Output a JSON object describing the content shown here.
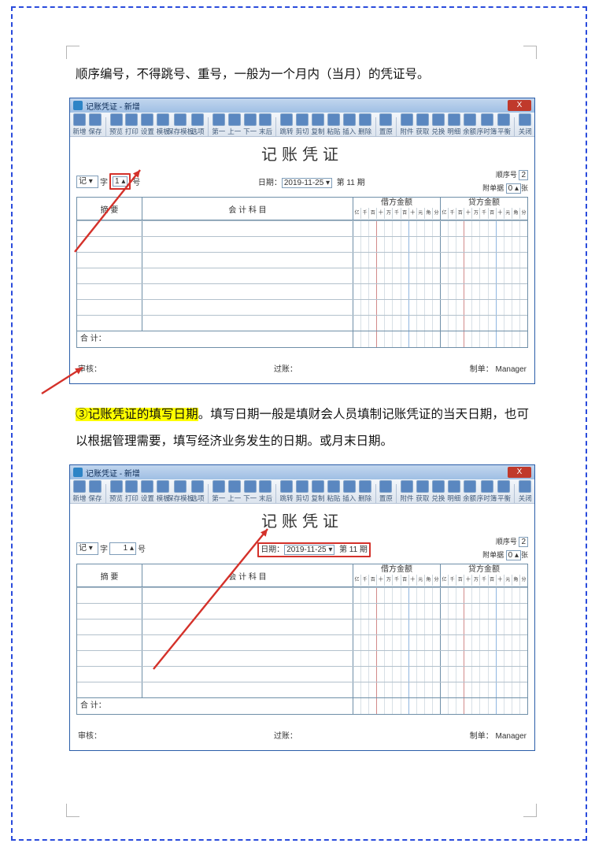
{
  "para1": "顺序编号，不得跳号、重号，一般为一个月内（当月）的凭证号。",
  "para2_hi": "③记账凭证的填写日期",
  "para2_punct": "。",
  "para2_rest": "填写日期一般是填财会人员填制记账凭证的当天日期，也可以根据管理需要，填写经济业务发生的日期。或月末日期。",
  "voucher": {
    "window_title": "记账凭证 - 新增",
    "close_label": "X",
    "toolbar": [
      "新增",
      "保存",
      "预览",
      "打印",
      "设置",
      "模板",
      "保存模板",
      "选项",
      "第一",
      "上一",
      "下一",
      "末后",
      "跳转",
      "剪切",
      "复制",
      "粘贴",
      "插入",
      "删除",
      "置原",
      "附件",
      "获取",
      "兑换",
      "明细",
      "余额",
      "序时簿",
      "平衡",
      "关闭"
    ],
    "title": "记账凭证",
    "zi_prefix": "记",
    "zi_label": "字",
    "num": "1",
    "num_suffix": "号",
    "date_label": "日期：",
    "date": "2019-11-25",
    "period_prefix": "第",
    "period_num": "11",
    "period_suffix": "期",
    "seq_label": "顺序号",
    "seq_val": "2",
    "attach_label": "附单据",
    "attach_val": "0",
    "attach_suffix": "张",
    "hdr_summary": "摘  要",
    "hdr_account": "会 计 科 目",
    "hdr_debit": "借方金额",
    "hdr_credit": "贷方金额",
    "digits": [
      "亿",
      "千",
      "百",
      "十",
      "万",
      "千",
      "百",
      "十",
      "元",
      "角",
      "分"
    ],
    "total_label": "合  计：",
    "footer_audit": "审核：",
    "footer_post": "过账：",
    "footer_make": "制单：",
    "footer_make_name": "Manager"
  }
}
